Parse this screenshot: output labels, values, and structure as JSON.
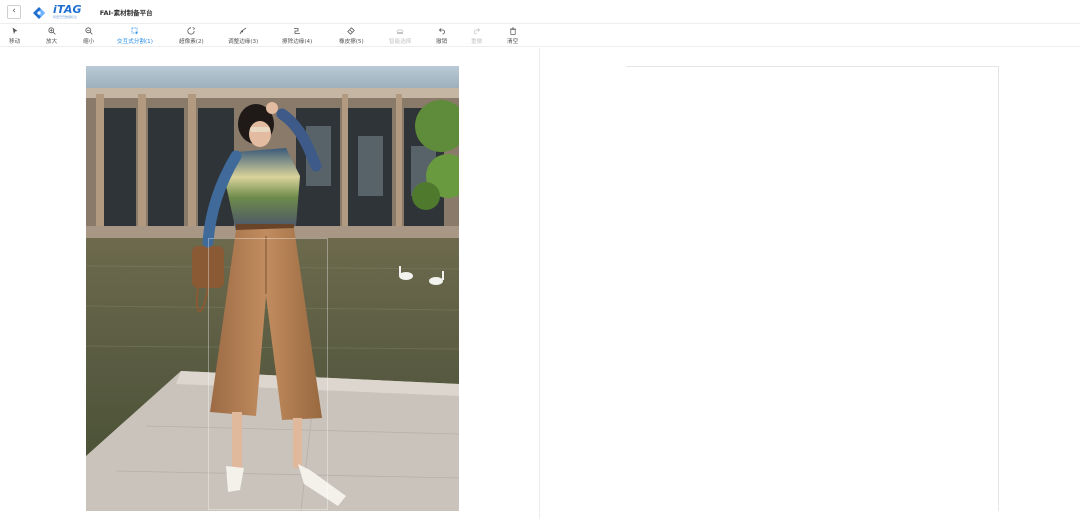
{
  "header": {
    "back_icon": "chevron-left-icon",
    "logo_word": "iTAG",
    "logo_sub": "阿里巴巴数据标注",
    "app_title": "FAI-素材制备平台"
  },
  "toolbar": {
    "items": [
      {
        "label": "移动",
        "icon": "cursor-icon",
        "state": "normal"
      },
      {
        "label": "放大",
        "icon": "zoom-in-icon",
        "state": "normal"
      },
      {
        "label": "缩小",
        "icon": "zoom-out-icon",
        "state": "normal"
      },
      {
        "label": "交互式分割(1)",
        "icon": "interactive-segment-icon",
        "state": "active"
      },
      {
        "label": "超像素(2)",
        "icon": "superpixel-icon",
        "state": "normal"
      },
      {
        "label": "调整边缘(3)",
        "icon": "adjust-edge-icon",
        "state": "normal"
      },
      {
        "label": "擦除边缘(4)",
        "icon": "erase-edge-icon",
        "state": "normal"
      },
      {
        "label": "橡皮擦(5)",
        "icon": "eraser-icon",
        "state": "normal"
      },
      {
        "label": "智能选择",
        "icon": "smart-select-icon",
        "state": "disabled"
      },
      {
        "label": "撤销",
        "icon": "undo-icon",
        "state": "normal"
      },
      {
        "label": "重做",
        "icon": "redo-icon",
        "state": "disabled"
      },
      {
        "label": "清空",
        "icon": "trash-icon",
        "state": "normal"
      }
    ]
  },
  "colors": {
    "accent": "#1e88e5",
    "logo": "#1f6fd1"
  }
}
